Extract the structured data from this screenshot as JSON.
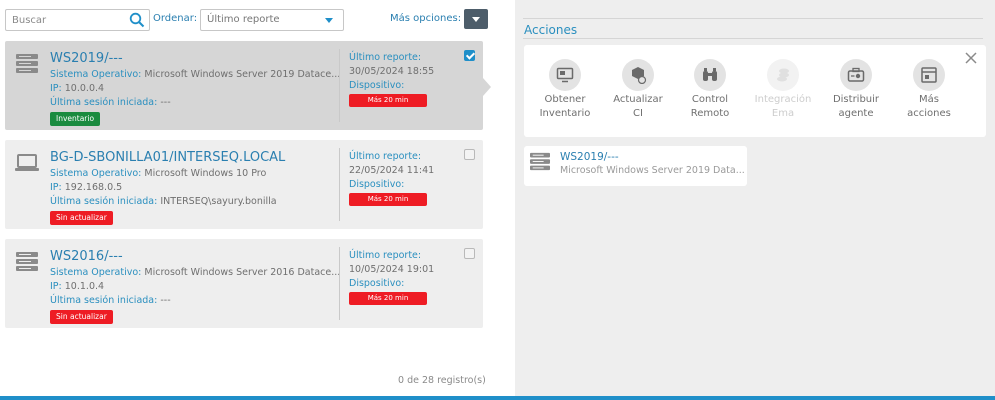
{
  "toolbar": {
    "search_placeholder": "Buscar",
    "sort_label": "Ordenar:",
    "sort_value": "Último reporte",
    "more_options_label": "Más opciones:"
  },
  "devices": [
    {
      "title": "WS2019/---",
      "os_label": "Sistema Operativo:",
      "os_value": "Microsoft Windows Server 2019 Datace...",
      "ip_label": "IP:",
      "ip_value": "10.0.0.4",
      "session_label": "Última sesión iniciada:",
      "session_value": "---",
      "badge": "Inventario",
      "report_label": "Último reporte:",
      "report_value": "30/05/2024 18:55",
      "device_label": "Dispositivo:",
      "device_badge": "Más 20 min",
      "icon": "server-icon",
      "checked": true
    },
    {
      "title": "BG-D-SBONILLA01/INTERSEQ.LOCAL",
      "os_label": "Sistema Operativo:",
      "os_value": "Microsoft Windows 10 Pro",
      "ip_label": "IP:",
      "ip_value": "192.168.0.5",
      "session_label": "Última sesión iniciada:",
      "session_value": "INTERSEQ\\sayury.bonilla",
      "badge": "Sin actualizar",
      "report_label": "Último reporte:",
      "report_value": "22/05/2024 11:41",
      "device_label": "Dispositivo:",
      "device_badge": "Más 20 min",
      "icon": "laptop-icon",
      "checked": false
    },
    {
      "title": "WS2016/---",
      "os_label": "Sistema Operativo:",
      "os_value": "Microsoft Windows Server 2016 Datace...",
      "ip_label": "IP:",
      "ip_value": "10.1.0.4",
      "session_label": "Última sesión iniciada:",
      "session_value": "---",
      "badge": "Sin actualizar",
      "report_label": "Último reporte:",
      "report_value": "10/05/2024 19:01",
      "device_label": "Dispositivo:",
      "device_badge": "Más 20 min",
      "icon": "server-icon",
      "checked": false
    }
  ],
  "record_count": "0 de 28 registro(s)",
  "actions_panel": {
    "title": "Acciones",
    "items": [
      {
        "label_1": "Obtener",
        "label_2": "Inventario",
        "icon": "monitor-icon",
        "enabled": true
      },
      {
        "label_1": "Actualizar",
        "label_2": "CI",
        "icon": "cube-refresh-icon",
        "enabled": true
      },
      {
        "label_1": "Control",
        "label_2": "Remoto",
        "icon": "binoculars-icon",
        "enabled": true
      },
      {
        "label_1": "Integración",
        "label_2": "Ema",
        "icon": "coins-icon",
        "enabled": false
      },
      {
        "label_1": "Distribuir",
        "label_2": "agente",
        "icon": "briefcase-gear-icon",
        "enabled": true
      },
      {
        "label_1": "Más",
        "label_2": "acciones",
        "icon": "window-icon",
        "enabled": true
      }
    ]
  },
  "selected_device": {
    "title": "WS2019/---",
    "subtitle": "Microsoft Windows Server 2019 Data..."
  },
  "colors": {
    "accent": "#1f8fc9",
    "link": "#2a7fb0",
    "badge_green": "#1a8b3f",
    "badge_red": "#ee1c24",
    "card_bg": "#eeeeee",
    "card_selected_bg": "#d6d6d6"
  }
}
